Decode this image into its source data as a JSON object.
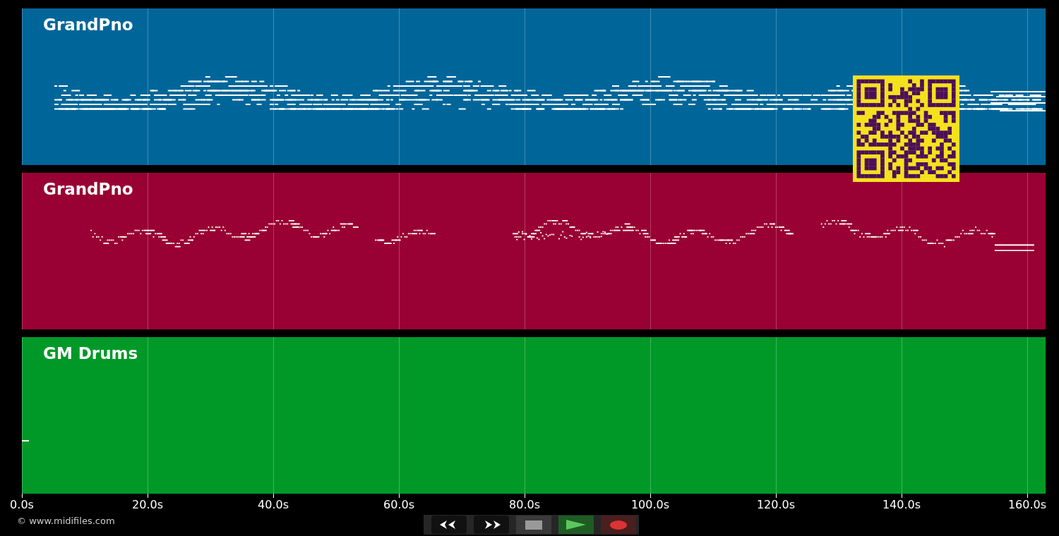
{
  "tracks": [
    {
      "name": "GrandPno",
      "color": "#006699"
    },
    {
      "name": "GrandPno",
      "color": "#990033"
    },
    {
      "name": "GM Drums",
      "color": "#009928"
    }
  ],
  "axis": {
    "ticks": [
      "0.0s",
      "20.0s",
      "40.0s",
      "60.0s",
      "80.0s",
      "100.0s",
      "120.0s",
      "140.0s",
      "160.0s"
    ]
  },
  "footer": {
    "copyright": "© www.midifiles.com"
  }
}
